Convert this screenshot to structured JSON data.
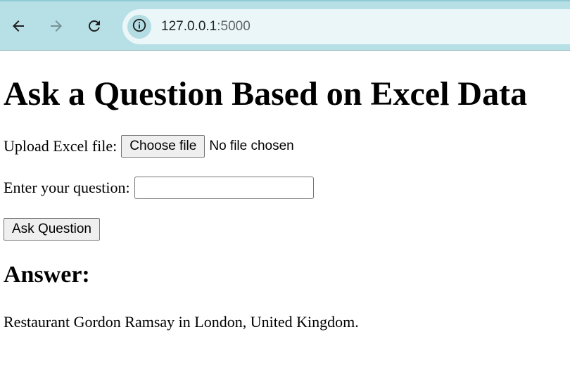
{
  "browser": {
    "url_host": "127.0.0.1",
    "url_port": ":5000",
    "icons": [
      "back-icon",
      "forward-icon",
      "reload-icon",
      "site-info-icon"
    ]
  },
  "page": {
    "title": "Ask a Question Based on Excel Data",
    "upload_label": "Upload Excel file:",
    "choose_file_label": "Choose file",
    "no_file_text": "No file chosen",
    "question_label": "Enter your question:",
    "question_value": "",
    "ask_button_label": "Ask Question",
    "answer_heading": "Answer:",
    "answer_text": "Restaurant Gordon Ramsay in London, United Kingdom."
  },
  "colors": {
    "toolbar_bg": "#b7e0e6",
    "omnibox_bg": "#eaf6f7",
    "forward_disabled": "#7a9296"
  }
}
